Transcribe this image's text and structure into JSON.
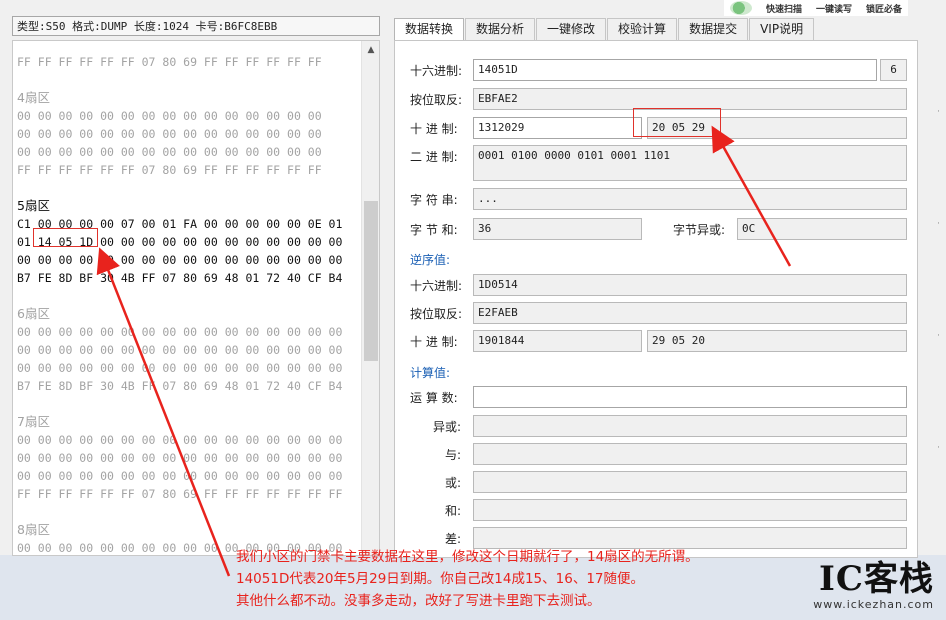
{
  "toolbar": {
    "quick_scan": "快速扫描",
    "one_key_rw": "一键读写",
    "lock_essential": "锁匠必备"
  },
  "left": {
    "info": "类型:S50 格式:DUMP 长度:1024 卡号:B6FC8EBB",
    "rows": [
      {
        "type": "hex",
        "class": "gray",
        "text": "FF FF FF FF FF FF 07 80 69 FF FF FF FF FF FF"
      },
      {
        "type": "gap"
      },
      {
        "type": "title",
        "class": "gray",
        "text": "4扇区"
      },
      {
        "type": "hex",
        "class": "gray",
        "text": "00 00 00 00 00 00 00 00 00 00 00 00 00 00 00"
      },
      {
        "type": "hex",
        "class": "gray",
        "text": "00 00 00 00 00 00 00 00 00 00 00 00 00 00 00"
      },
      {
        "type": "hex",
        "class": "gray",
        "text": "00 00 00 00 00 00 00 00 00 00 00 00 00 00 00"
      },
      {
        "type": "hex",
        "class": "gray",
        "text": "FF FF FF FF FF FF 07 80 69 FF FF FF FF FF FF"
      },
      {
        "type": "gap"
      },
      {
        "type": "title",
        "class": "dark",
        "text": "5扇区"
      },
      {
        "type": "hex",
        "class": "dark",
        "text": "C1 00 00 00 00 07 00 01 FA 00 00 00 00 00 0E 01"
      },
      {
        "type": "hex",
        "class": "dark",
        "text": "01 14 05 1D 00 00 00 00 00 00 00 00 00 00 00 00"
      },
      {
        "type": "hex",
        "class": "dark",
        "text": "00 00 00 00 00 00 00 00 00 00 00 00 00 00 00 00"
      },
      {
        "type": "hex",
        "class": "dark",
        "text": "B7 FE 8D BF 30 4B FF 07 80 69 48 01 72 40 CF B4"
      },
      {
        "type": "gap"
      },
      {
        "type": "title",
        "class": "gray",
        "text": "6扇区"
      },
      {
        "type": "hex",
        "class": "gray",
        "text": "00 00 00 00 00 00 00 00 00 00 00 00 00 00 00 00"
      },
      {
        "type": "hex",
        "class": "gray",
        "text": "00 00 00 00 00 00 00 00 00 00 00 00 00 00 00 00"
      },
      {
        "type": "hex",
        "class": "gray",
        "text": "00 00 00 00 00 00 00 00 00 00 00 00 00 00 00 00"
      },
      {
        "type": "hex",
        "class": "gray",
        "text": "B7 FE 8D BF 30 4B FF 07 80 69 48 01 72 40 CF B4"
      },
      {
        "type": "gap"
      },
      {
        "type": "title",
        "class": "gray",
        "text": "7扇区"
      },
      {
        "type": "hex",
        "class": "gray",
        "text": "00 00 00 00 00 00 00 00 00 00 00 00 00 00 00 00"
      },
      {
        "type": "hex",
        "class": "gray",
        "text": "00 00 00 00 00 00 00 00 00 00 00 00 00 00 00 00"
      },
      {
        "type": "hex",
        "class": "gray",
        "text": "00 00 00 00 00 00 00 00 00 00 00 00 00 00 00 00"
      },
      {
        "type": "hex",
        "class": "gray",
        "text": "FF FF FF FF FF FF 07 80 69 FF FF FF FF FF FF FF"
      },
      {
        "type": "gap"
      },
      {
        "type": "title",
        "class": "gray",
        "text": "8扇区"
      },
      {
        "type": "hex",
        "class": "gray",
        "text": "00 00 00 00 00 00 00 00 00 00 00 00 00 00 00 00"
      }
    ]
  },
  "tabs": [
    "数据转换",
    "数据分析",
    "一键修改",
    "校验计算",
    "数据提交",
    "VIP说明"
  ],
  "convert": {
    "hex_label": "十六进制:",
    "hex_value": "14051D",
    "hex_len": "6",
    "invert_label": "按位取反:",
    "invert_value": "EBFAE2",
    "dec_label": "十 进 制:",
    "dec_value": "1312029",
    "dec_bytes": "20 05 29",
    "bin_label": "二 进 制:",
    "bin_value": "0001 0100 0000 0101 0001 1101",
    "str_label": "字 符 串:",
    "str_value": "...",
    "sum_label": "字 节 和:",
    "sum_value": "36",
    "xor_label": "字节异或:",
    "xor_value": "0C"
  },
  "reverse": {
    "title": "逆序值:",
    "hex_label": "十六进制:",
    "hex_value": "1D0514",
    "invert_label": "按位取反:",
    "invert_value": "E2FAEB",
    "dec_label": "十 进 制:",
    "dec_value": "1901844",
    "dec_bytes": "29 05 20"
  },
  "calc": {
    "title": "计算值:",
    "operand_label": "运 算 数:",
    "xor_label": "异或:",
    "and_label": "与:",
    "or_label": "或:",
    "sum_label": "和:",
    "diff_label": "差:"
  },
  "annotation": [
    "我们小区的门禁卡主要数据在这里，修改这个日期就行了，14扇区的无所谓。",
    "14051D代表20年5月29日到期。你自己改14成15、16、17随便。",
    "其他什么都不动。没事多走动，改好了写进卡里跑下去测试。"
  ],
  "brand": {
    "name": "IC客栈",
    "url": "www.ickezhan.com"
  },
  "colors": {
    "annotation_red": "#e8231d",
    "section_blue": "#1a5fb4"
  }
}
